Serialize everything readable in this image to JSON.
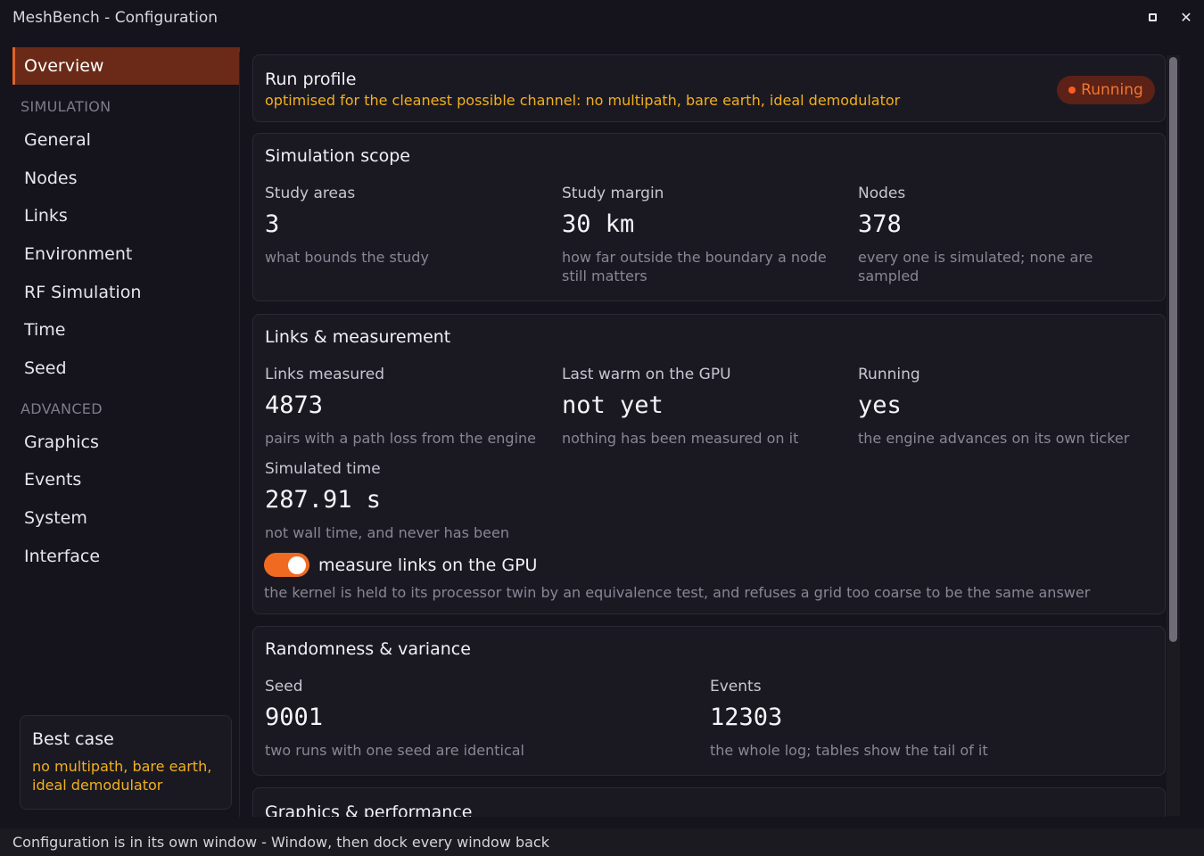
{
  "window": {
    "title": "MeshBench - Configuration",
    "maximize_icon": "maximize-icon",
    "close_label": "✕"
  },
  "sidebar": {
    "items_top": [
      "Overview"
    ],
    "section_simulation": "SIMULATION",
    "simulation_items": [
      "General",
      "Nodes",
      "Links",
      "Environment",
      "RF Simulation",
      "Time",
      "Seed"
    ],
    "section_advanced": "ADVANCED",
    "advanced_items": [
      "Graphics",
      "Events",
      "System",
      "Interface"
    ],
    "active_item": "Overview",
    "best_case": {
      "title": "Best case",
      "description": "no multipath, bare earth, ideal demodulator"
    }
  },
  "run_profile": {
    "title": "Run profile",
    "subtitle": "optimised for the cleanest possible channel: no multipath, bare earth, ideal demodulator",
    "status_badge": "Running"
  },
  "simulation_scope": {
    "title": "Simulation scope",
    "fields": [
      {
        "label": "Study areas",
        "value": "3",
        "hint": "what bounds the study"
      },
      {
        "label": "Study margin",
        "value": "30 km",
        "hint": "how far outside the boundary a node still matters"
      },
      {
        "label": "Nodes",
        "value": "378",
        "hint": "every one is simulated; none are sampled"
      }
    ]
  },
  "links_measurement": {
    "title": "Links & measurement",
    "fields": [
      {
        "label": "Links measured",
        "value": "4873",
        "hint": "pairs with a path loss from the engine"
      },
      {
        "label": "Last warm on the GPU",
        "value": "not yet",
        "hint": "nothing has been measured on it"
      },
      {
        "label": "Running",
        "value": "yes",
        "hint": "the engine advances on its own ticker"
      },
      {
        "label": "Simulated time",
        "value": "287.91 s",
        "hint": "not wall time, and never has been"
      }
    ],
    "gpu_toggle": {
      "label": "measure links on the GPU",
      "checked": true,
      "hint": "the kernel is held to its processor twin by an equivalence test, and refuses a grid too coarse to be the same answer"
    }
  },
  "randomness_variance": {
    "title": "Randomness & variance",
    "fields": [
      {
        "label": "Seed",
        "value": "9001",
        "hint": "two runs with one seed are identical"
      },
      {
        "label": "Events",
        "value": "12303",
        "hint": "the whole log; tables show the tail of it"
      }
    ]
  },
  "graphics_performance": {
    "title": "Graphics & performance"
  },
  "statusbar": {
    "text": "Configuration is in its own window - Window, then dock every window back"
  },
  "colors": {
    "accent": "#f06a22",
    "active_nav_bg": "#6b2a17",
    "warning_text": "#f3b01d",
    "background": "#15141c",
    "card_bg": "#1a1922"
  }
}
